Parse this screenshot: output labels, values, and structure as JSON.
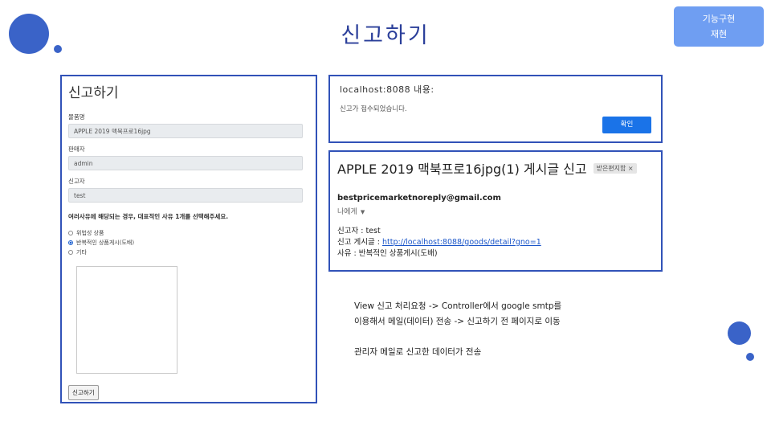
{
  "slide": {
    "title": "신고하기",
    "tag_line1": "기능구현",
    "tag_line2": "재현"
  },
  "form": {
    "title": "신고하기",
    "product_label": "물품명",
    "product_value": "APPLE 2019 맥북프로16jpg",
    "seller_label": "판매자",
    "seller_value": "admin",
    "reporter_label": "신고자",
    "reporter_value": "test",
    "note": "여러사유에 해당되는 경우, 대표적인 사유 1개를 선택해주세요.",
    "reasons": [
      {
        "label": "위법성 상품",
        "checked": false
      },
      {
        "label": "반복적인 상품게시(도배)",
        "checked": true
      },
      {
        "label": "기타",
        "checked": false
      }
    ],
    "submit_label": "신고하기"
  },
  "alert": {
    "host": "localhost:8088 내용:",
    "message": "신고가 접수되었습니다.",
    "ok_label": "확인"
  },
  "email": {
    "subject": "APPLE 2019 맥북프로16jpg(1) 게시글 신고",
    "badge": "받은편지함 ×",
    "from": "bestpricemarketnoreply@gmail.com",
    "to": "나에게",
    "reporter_line": "신고자 : test",
    "post_prefix": "신고 게시글 : ",
    "post_link": "http://localhost:8088/goods/detail?gno=1",
    "reason_line": "사유 : 반복적인 상품게시(도배)"
  },
  "notes": {
    "line1": "View 신고 처리요청 -> Controller에서 google smtp를",
    "line2": "이용해서 메일(데이터) 전송 -> 신고하기 전 페이지로 이동",
    "line3": "관리자 메일로 신고한 데이터가 전송"
  },
  "colors": {
    "accent": "#3152b8",
    "tag_bg": "#6f9ef2",
    "ok_button": "#1a73e8"
  }
}
